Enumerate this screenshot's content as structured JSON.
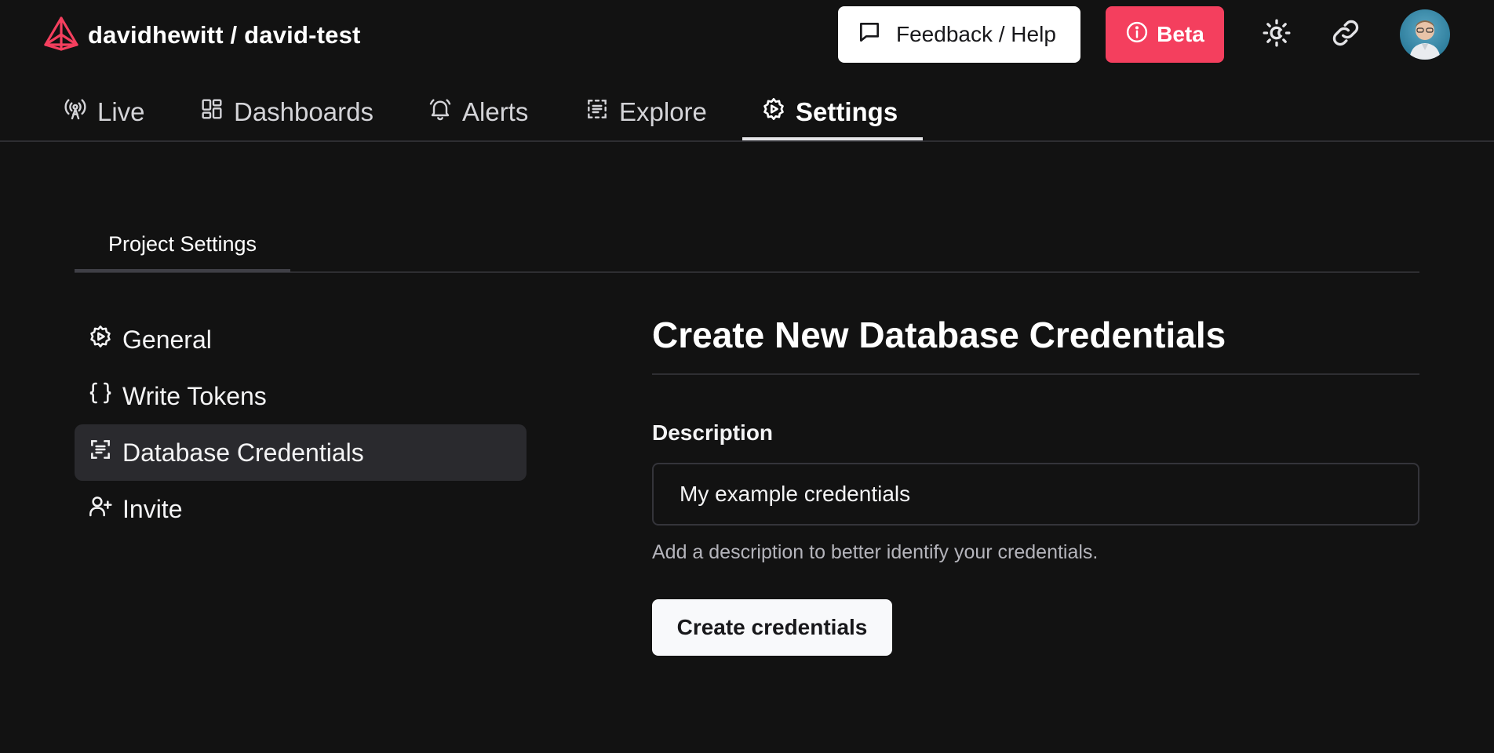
{
  "brand": {
    "title": "davidhewitt / david-test",
    "logo_icon": "pyramid-logo",
    "logo_color": "#f43f5e"
  },
  "header": {
    "feedback_label": "Feedback / Help",
    "beta_label": "Beta",
    "theme_icon": "sun-moon-icon",
    "link_icon": "link-icon",
    "avatar_icon": "user-avatar"
  },
  "nav": {
    "items": [
      {
        "label": "Live",
        "icon": "broadcast-icon"
      },
      {
        "label": "Dashboards",
        "icon": "dashboard-grid-icon"
      },
      {
        "label": "Alerts",
        "icon": "bell-icon"
      },
      {
        "label": "Explore",
        "icon": "explore-icon"
      },
      {
        "label": "Settings",
        "icon": "gear-icon",
        "active": true
      }
    ]
  },
  "subtabs": {
    "items": [
      {
        "label": "Project Settings",
        "active": true
      }
    ]
  },
  "sidebar": {
    "items": [
      {
        "label": "General",
        "icon": "gear-icon"
      },
      {
        "label": "Write Tokens",
        "icon": "braces-icon"
      },
      {
        "label": "Database Credentials",
        "icon": "database-credentials-icon",
        "active": true
      },
      {
        "label": "Invite",
        "icon": "user-plus-icon"
      }
    ]
  },
  "main": {
    "title": "Create New Database Credentials",
    "description_label": "Description",
    "description_value": "My example credentials",
    "helper_text": "Add a description to better identify your credentials.",
    "create_button": "Create credentials"
  },
  "colors": {
    "background": "#121212",
    "accent": "#f43f5e",
    "active_bg": "#2a2a2e",
    "border": "#2e2e32"
  }
}
